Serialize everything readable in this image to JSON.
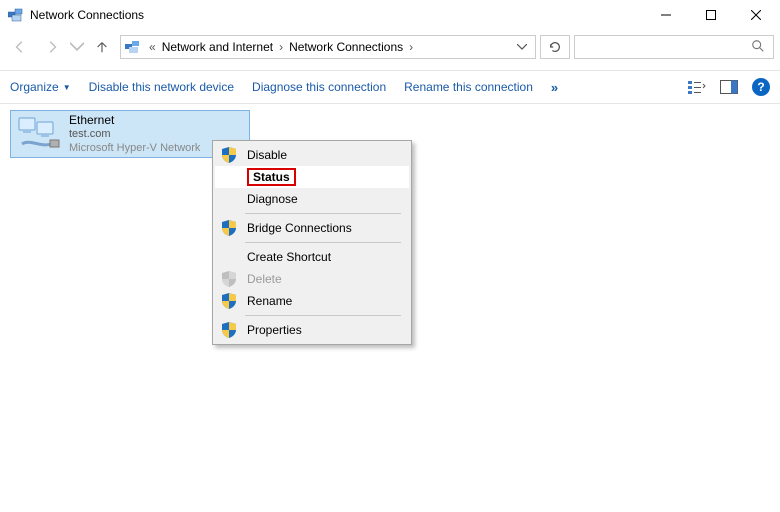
{
  "window": {
    "title": "Network Connections"
  },
  "breadcrumb": {
    "prefix": "«",
    "items": [
      "Network and Internet",
      "Network Connections"
    ]
  },
  "search": {
    "placeholder": ""
  },
  "commands": {
    "organize": "Organize",
    "disable_device": "Disable this network device",
    "diagnose": "Diagnose this connection",
    "rename": "Rename this connection",
    "overflow": "»"
  },
  "adapter": {
    "name": "Ethernet",
    "status": "test.com",
    "device": "Microsoft Hyper-V Network"
  },
  "context_menu": {
    "items": [
      {
        "label": "Disable",
        "shield": true,
        "enabled": true,
        "highlighted": false
      },
      {
        "label": "Status",
        "shield": false,
        "enabled": true,
        "highlighted": true
      },
      {
        "label": "Diagnose",
        "shield": false,
        "enabled": true,
        "highlighted": false
      },
      {
        "sep": true
      },
      {
        "label": "Bridge Connections",
        "shield": true,
        "enabled": true,
        "highlighted": false
      },
      {
        "sep": true
      },
      {
        "label": "Create Shortcut",
        "shield": false,
        "enabled": true,
        "highlighted": false
      },
      {
        "label": "Delete",
        "shield": true,
        "enabled": false,
        "highlighted": false
      },
      {
        "label": "Rename",
        "shield": true,
        "enabled": true,
        "highlighted": false
      },
      {
        "sep": true
      },
      {
        "label": "Properties",
        "shield": true,
        "enabled": true,
        "highlighted": false
      }
    ]
  }
}
